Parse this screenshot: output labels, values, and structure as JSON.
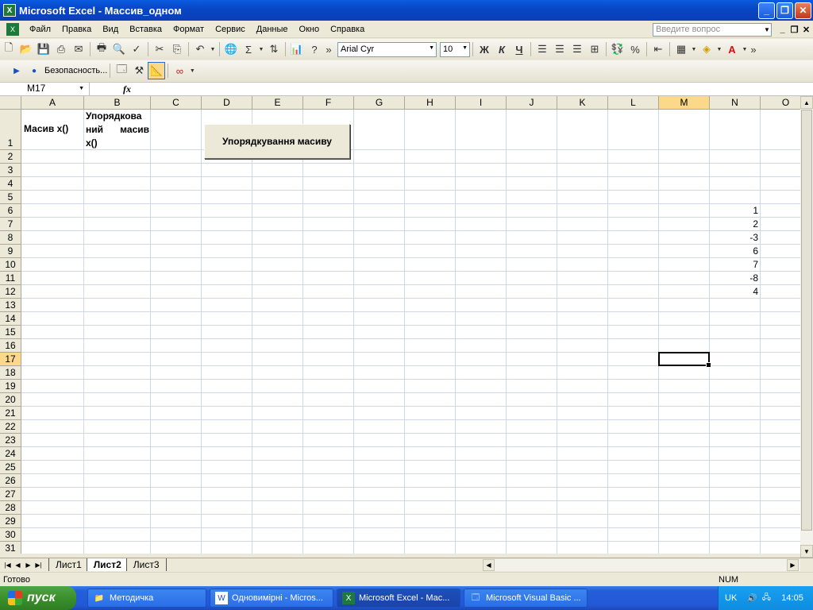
{
  "window": {
    "title": "Microsoft Excel - Массив_одном"
  },
  "menu": {
    "items": [
      "Файл",
      "Правка",
      "Вид",
      "Вставка",
      "Формат",
      "Сервис",
      "Данные",
      "Окно",
      "Справка"
    ],
    "help_placeholder": "Введите вопрос"
  },
  "toolbar": {
    "font_name": "Arial Cyr",
    "font_size": "10",
    "bold": "Ж",
    "italic": "К",
    "underline": "Ч",
    "security_label": "Безопасность..."
  },
  "formula": {
    "name_box": "M17",
    "fx": "fx",
    "content": ""
  },
  "grid": {
    "columns": [
      "A",
      "B",
      "C",
      "D",
      "E",
      "F",
      "G",
      "H",
      "I",
      "J",
      "K",
      "L",
      "M",
      "N",
      "O"
    ],
    "active_column": "M",
    "rows": [
      "1",
      "2",
      "3",
      "4",
      "5",
      "6",
      "7",
      "8",
      "9",
      "10",
      "11",
      "12",
      "13",
      "14",
      "15",
      "16",
      "17",
      "18",
      "19",
      "20",
      "21",
      "22",
      "23",
      "24",
      "25",
      "26",
      "27",
      "28",
      "29",
      "30",
      "31"
    ],
    "active_row": "17",
    "cells": {
      "A1": "Масив x()",
      "B1_line1": "Упорядкова",
      "B1_line2": "ний    масив",
      "B1_line3": "x()",
      "N6": "1",
      "N7": "2",
      "N8": "-3",
      "N9": "6",
      "N10": "7",
      "N11": "-8",
      "N12": "4"
    },
    "form_button": "Упорядкування масиву"
  },
  "sheets": {
    "tabs": [
      "Лист1",
      "Лист2",
      "Лист3"
    ],
    "active": "Лист2"
  },
  "status": {
    "text": "Готово",
    "num": "NUM"
  },
  "taskbar": {
    "start": "пуск",
    "tasks": [
      "Методичка",
      "Одновимірні - Micros...",
      "Microsoft Excel - Мас...",
      "Microsoft Visual Basic ..."
    ],
    "active_task": "Microsoft Excel - Мас...",
    "lang": "UK",
    "clock": "14:05"
  }
}
